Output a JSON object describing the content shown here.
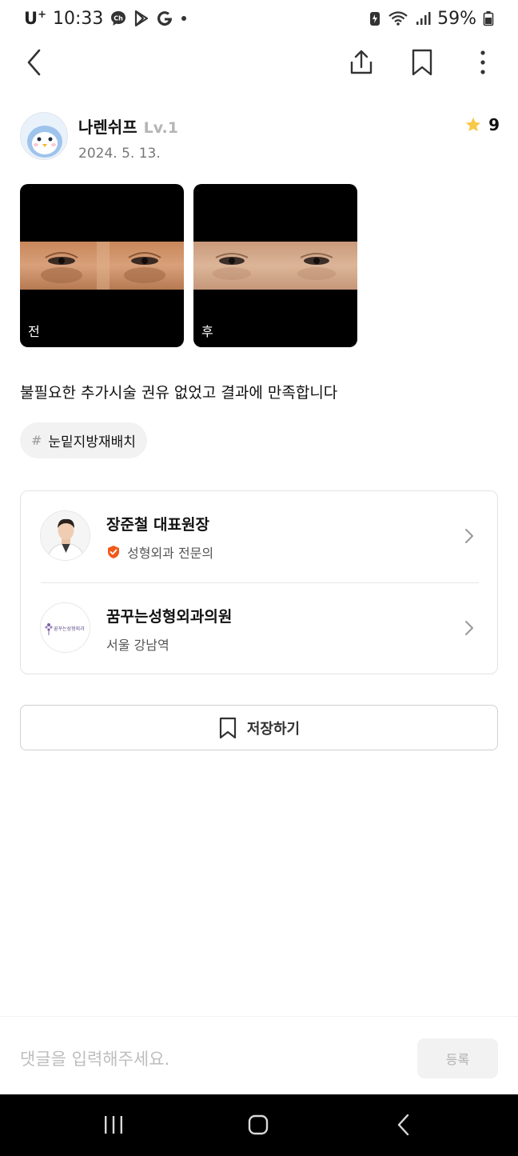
{
  "status_bar": {
    "carrier": "U",
    "carrier_sup": "+",
    "time": "10:33",
    "icons": [
      "chat-ch-icon",
      "play-store-icon",
      "google-icon",
      "dot-icon",
      "battery-saver-icon",
      "wifi-icon",
      "signal-icon",
      "battery-icon"
    ],
    "battery": "59%"
  },
  "top_nav": {
    "icons": [
      "back-arrow-icon",
      "share-icon",
      "bookmark-icon",
      "more-vertical-icon"
    ]
  },
  "author": {
    "name": "나렌쉬프",
    "level": "Lv.1",
    "date": "2024. 5. 13.",
    "rating": "9",
    "avatar_icon": "penguin-avatar-icon"
  },
  "photos": [
    {
      "label": "전"
    },
    {
      "label": "후"
    }
  ],
  "review_text": "불필요한 추가시술 권유 없었고 결과에 만족합니다",
  "tag": {
    "hash": "#",
    "label": "눈밑지방재배치"
  },
  "doctor": {
    "name": "장준철 대표원장",
    "specialty": "성형외과 전문의",
    "badge_color": "#f05a1a"
  },
  "clinic": {
    "name": "꿈꾸는성형외과의원",
    "location": "서울 강남역",
    "logo_text": "꿈꾸는성형외과"
  },
  "save_button": {
    "label": "저장하기"
  },
  "comment": {
    "placeholder": "댓글을 입력해주세요.",
    "submit_label": "등록"
  },
  "colors": {
    "star": "#f7c948",
    "background": "#ffffff",
    "nav_bar": "#000000"
  }
}
